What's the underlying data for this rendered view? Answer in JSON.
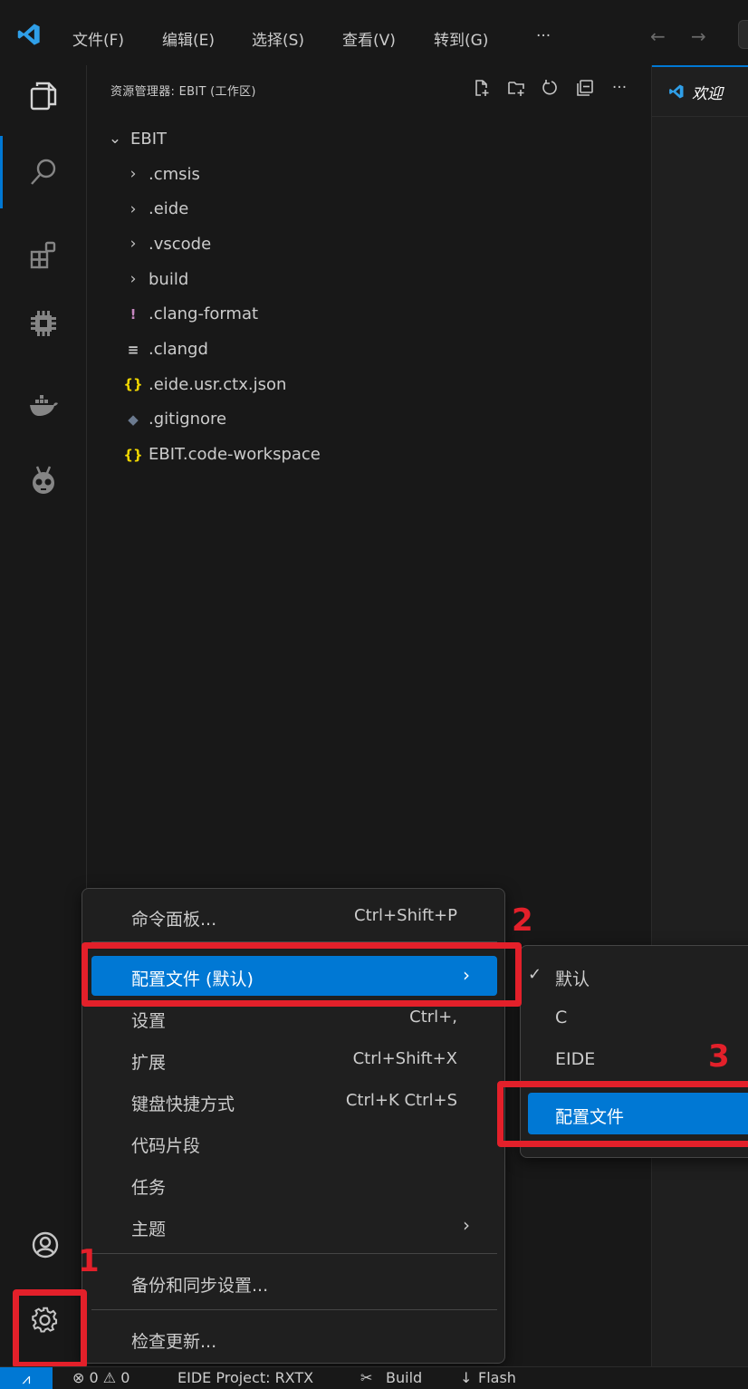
{
  "titlebar": {
    "menus": [
      "文件(F)",
      "编辑(E)",
      "选择(S)",
      "查看(V)",
      "转到(G)",
      "···"
    ],
    "back_arrow": "←",
    "forward_arrow": "→"
  },
  "activity_bar": {
    "icons": [
      "explorer-icon",
      "search-icon",
      "extensions-icon",
      "chip-icon",
      "docker-icon",
      "platformio-icon"
    ],
    "bottom_icons": [
      "account-icon",
      "manage-gear-icon"
    ]
  },
  "explorer": {
    "title": "资源管理器: EBIT (工作区)",
    "actions": [
      "new-file-icon",
      "new-folder-icon",
      "refresh-icon",
      "collapse-all-icon",
      "more-icon"
    ],
    "root": "EBIT",
    "items": [
      {
        "type": "folder",
        "name": ".cmsis",
        "icon": "›"
      },
      {
        "type": "folder",
        "name": ".eide",
        "icon": "›"
      },
      {
        "type": "folder",
        "name": ".vscode",
        "icon": "›"
      },
      {
        "type": "folder",
        "name": "build",
        "icon": "›"
      },
      {
        "type": "file",
        "name": ".clang-format",
        "icon": "!",
        "color": "#c586c0"
      },
      {
        "type": "file",
        "name": ".clangd",
        "icon": "≡",
        "color": "#cccccc"
      },
      {
        "type": "file",
        "name": ".eide.usr.ctx.json",
        "icon": "{}",
        "color": "#f1d700"
      },
      {
        "type": "file",
        "name": ".gitignore",
        "icon": "◆",
        "color": "#6b7a8f"
      },
      {
        "type": "file",
        "name": "EBIT.code-workspace",
        "icon": "{}",
        "color": "#f1d700"
      }
    ]
  },
  "editor": {
    "tab_label": "欢迎"
  },
  "context_menu": {
    "items": [
      {
        "label": "命令面板...",
        "shortcut": "Ctrl+Shift+P"
      },
      {
        "label": "配置文件 (默认)",
        "shortcut": "",
        "submenu": true,
        "highlighted": true
      },
      {
        "label": "设置",
        "shortcut": "Ctrl+,"
      },
      {
        "label": "扩展",
        "shortcut": "Ctrl+Shift+X"
      },
      {
        "label": "键盘快捷方式",
        "shortcut": "Ctrl+K Ctrl+S"
      },
      {
        "label": "代码片段",
        "shortcut": ""
      },
      {
        "label": "任务",
        "shortcut": ""
      },
      {
        "label": "主题",
        "shortcut": "",
        "submenu": true
      },
      {
        "label": "备份和同步设置...",
        "shortcut": ""
      },
      {
        "label": "检查更新...",
        "shortcut": ""
      }
    ]
  },
  "profile_submenu": {
    "items": [
      {
        "label": "默认",
        "checked": true
      },
      {
        "label": "C",
        "checked": false
      },
      {
        "label": "EIDE",
        "checked": false
      },
      {
        "label": "配置文件",
        "checked": false,
        "highlighted": true
      }
    ]
  },
  "annotations": {
    "step1": "1",
    "step2": "2",
    "step3": "3",
    "color": "#e3202a"
  },
  "statusbar": {
    "problems": "⊗ 0 ⚠ 0",
    "project": "EIDE Project: RXTX",
    "build": "Build",
    "flash": "Flash"
  },
  "colors": {
    "accent": "#0078d4",
    "background": "#181818",
    "editor_bg": "#1f1f1f",
    "text": "#cccccc"
  }
}
